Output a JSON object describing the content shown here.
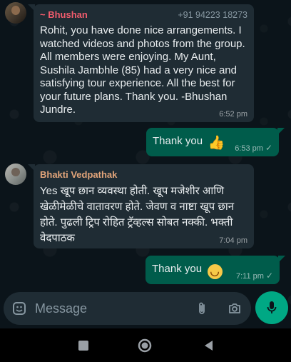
{
  "messages": [
    {
      "sender": "~ Bhushan",
      "phone": "+91 94223 18273",
      "text": "Rohit, you have done nice arrangements. I watched videos and photos from the group. All members were enjoying. My Aunt, Sushila Jambhle (85) had a very nice and satisfying tour experience. All the best for your future plans. Thank you. -Bhushan Jundre.",
      "time": "6:52 pm"
    },
    {
      "text": "Thank you",
      "emoji": "thumbs-up",
      "time": "6:53 pm"
    },
    {
      "sender": "Bhakti Vedpathak",
      "text": "Yes खूप छान व्यवस्था होती. खूप मजेशीर आणि खेळीमेळीचे वातावरण होते. जेवण व नाष्टा खूप छान होते. पुढली ट्रिप रोहित ट्रॅव्हल्स सोबत नक्की. भक्ती वेदपाठक",
      "time": "7:04 pm"
    },
    {
      "text": "Thank you",
      "emoji": "smiling-face",
      "time": "7:11 pm"
    }
  ],
  "composer": {
    "placeholder": "Message",
    "icons": [
      "sticker-icon",
      "attach-icon",
      "camera-icon",
      "mic-icon"
    ]
  },
  "navbar": {
    "icons": [
      "recents-icon",
      "home-icon",
      "back-icon"
    ]
  },
  "colors": {
    "background": "#0b141a",
    "incoming_bubble": "#1f2c34",
    "outgoing_bubble": "#005c4b",
    "accent": "#00a884"
  }
}
